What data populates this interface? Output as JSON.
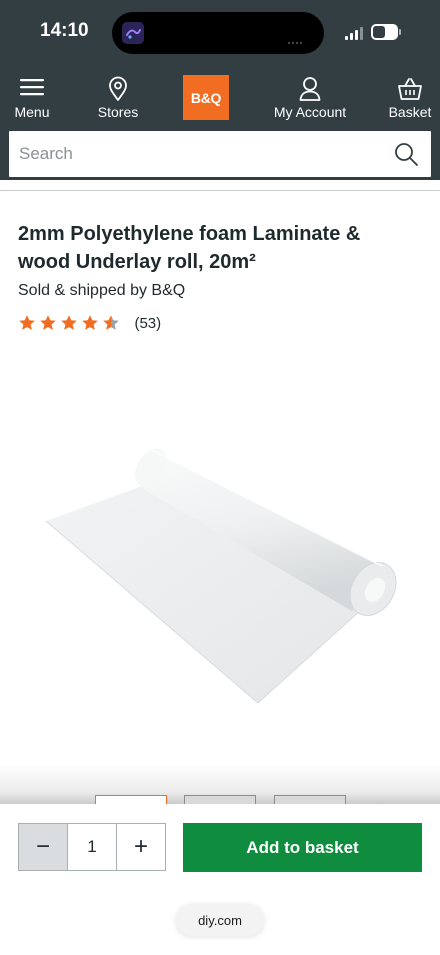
{
  "status_bar": {
    "time": "14:10"
  },
  "navbar": {
    "menu_label": "Menu",
    "stores_label": "Stores",
    "logo_text": "B&Q",
    "account_label": "My Account",
    "basket_label": "Basket"
  },
  "search": {
    "placeholder": "Search"
  },
  "product": {
    "title": "2mm Polyethylene foam Laminate & wood Underlay roll, 20m²",
    "seller": "Sold & shipped by B&Q",
    "rating_stars": 4.5,
    "rating_max": 5,
    "rating_count": "(53)"
  },
  "buy": {
    "qty_minus": "−",
    "quantity": "1",
    "qty_plus": "+",
    "add_label": "Add to basket"
  },
  "browser": {
    "url": "diy.com"
  },
  "colors": {
    "header_bg": "#333e42",
    "brand_orange": "#f16d22",
    "add_green": "#108c3e",
    "star_orange": "#f16d22"
  },
  "icons": [
    "menu-icon",
    "map-pin-icon",
    "user-icon",
    "basket-icon",
    "search-icon",
    "star-icon",
    "minus-icon",
    "plus-icon"
  ]
}
